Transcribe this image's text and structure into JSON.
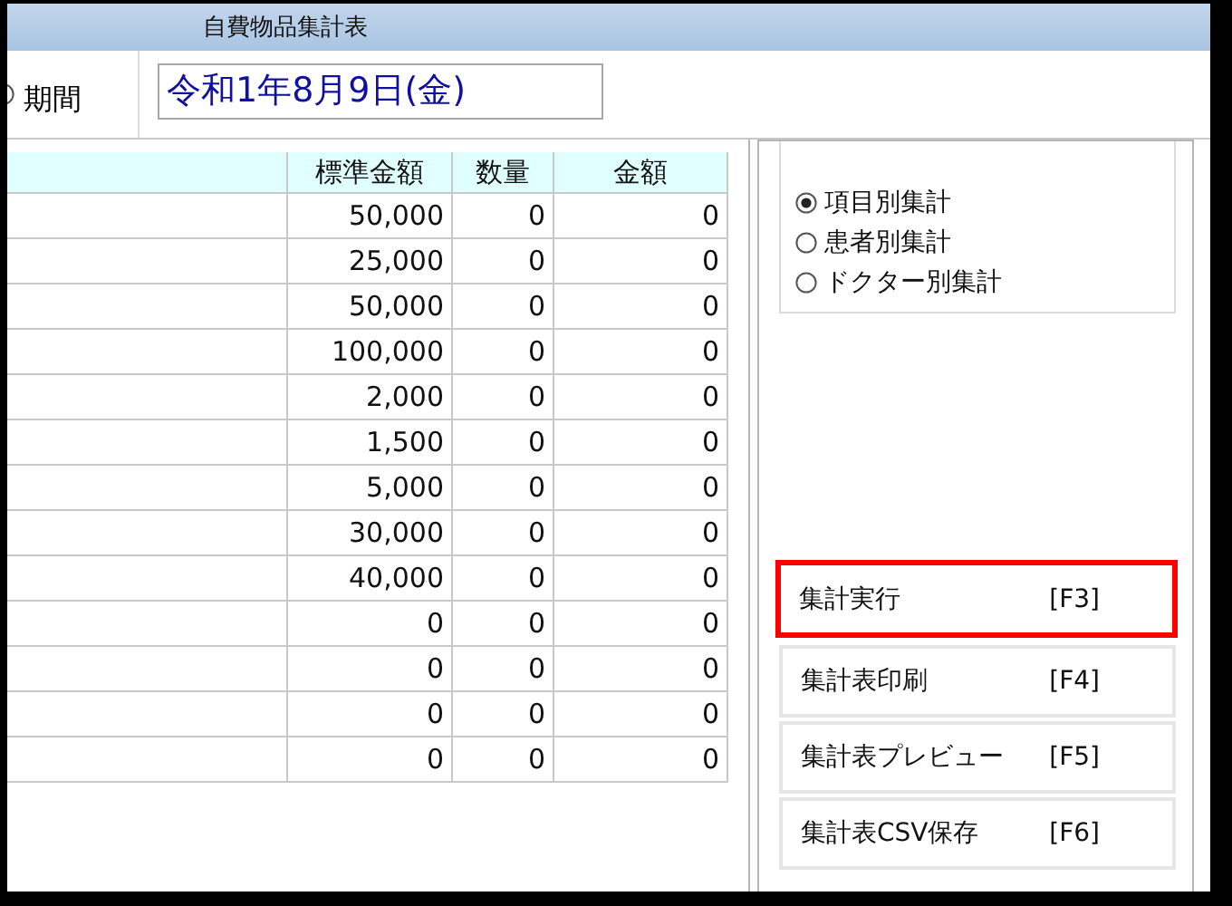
{
  "window": {
    "title": "自費物品集計表"
  },
  "period": {
    "label": "期間",
    "selected": false
  },
  "date_field": {
    "value": "令和1年8月9日(金)"
  },
  "table": {
    "columns": [
      "標準金額",
      "数量",
      "金額"
    ],
    "rows": [
      [
        "50,000",
        "0",
        "0"
      ],
      [
        "25,000",
        "0",
        "0"
      ],
      [
        "50,000",
        "0",
        "0"
      ],
      [
        "100,000",
        "0",
        "0"
      ],
      [
        "2,000",
        "0",
        "0"
      ],
      [
        "1,500",
        "0",
        "0"
      ],
      [
        "5,000",
        "0",
        "0"
      ],
      [
        "30,000",
        "0",
        "0"
      ],
      [
        "40,000",
        "0",
        "0"
      ],
      [
        "0",
        "0",
        "0"
      ],
      [
        "0",
        "0",
        "0"
      ],
      [
        "0",
        "0",
        "0"
      ],
      [
        "0",
        "0",
        "0"
      ]
    ]
  },
  "mode_options": [
    {
      "label": "項目別集計",
      "selected": true
    },
    {
      "label": "患者別集計",
      "selected": false
    },
    {
      "label": "ドクター別集計",
      "selected": false
    }
  ],
  "buttons": [
    {
      "label": "集計実行",
      "key": "[F3]",
      "highlighted": true
    },
    {
      "label": "集計表印刷",
      "key": "[F4]",
      "highlighted": false
    },
    {
      "label": "集計表プレビュー",
      "key": "[F5]",
      "highlighted": false
    },
    {
      "label": "集計表CSV保存",
      "key": "[F6]",
      "highlighted": false
    }
  ]
}
